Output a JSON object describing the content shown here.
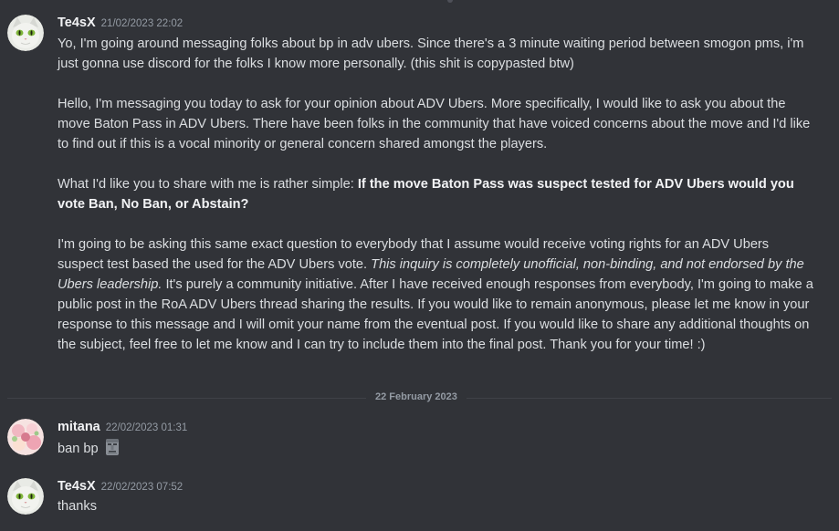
{
  "messages": [
    {
      "username": "Te4sX",
      "timestamp": "21/02/2023 22:02",
      "paragraphs": {
        "p1": "Yo, I'm going around messaging folks about bp in adv ubers. Since there's a 3 minute waiting period between smogon pms, i'm just gonna use discord for the folks I know more personally. (this shit is copypasted btw)",
        "p2": "Hello, I'm messaging you today to ask for your opinion about ADV Ubers. More specifically, I would like to ask you about the move Baton Pass in ADV Ubers. There have been folks in the community that have voiced concerns about the move and I'd like to find out if this is a vocal minority or general concern shared amongst the players.",
        "p3_prefix": "What I'd like you to share with me is rather simple: ",
        "p3_bold": "If the move Baton Pass was suspect tested for ADV Ubers would you vote Ban, No Ban, or Abstain?",
        "p4_prefix": "I'm going to be asking this same exact question to everybody that I assume would receive voting rights for an ADV Ubers suspect test based the used for the  ADV Ubers vote. ",
        "p4_italic": "This inquiry is completely unofficial, non-binding, and not endorsed by the Ubers leadership.",
        "p4_suffix": " It's purely a community initiative. After I have received enough responses from everybody, I'm going to make a public post in the RoA ADV Ubers thread sharing the results. If you would like to remain anonymous, please let me know in your response to this message and I will omit your name from the eventual post. If you would like to share any additional thoughts on the subject, feel free to let me know and I can try to include them into the final post. Thank you for your time! :)"
      }
    },
    {
      "username": "mitana",
      "timestamp": "22/02/2023 01:31",
      "text": "ban bp",
      "emoji": "moai-icon"
    },
    {
      "username": "Te4sX",
      "timestamp": "22/02/2023 07:52",
      "text": "thanks"
    }
  ],
  "date_divider": "22 February 2023",
  "colors": {
    "background": "#313338",
    "text": "#dbdee1",
    "username": "#f2f3f5",
    "timestamp": "#949ba4"
  }
}
